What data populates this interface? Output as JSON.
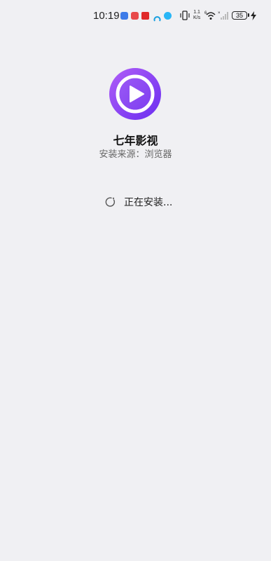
{
  "status_bar": {
    "time": "10:19",
    "net_speed_value": "1.1",
    "net_speed_unit": "K/s",
    "battery_level": "35",
    "notification_icons": [
      "app-notification-blue",
      "app-notification-red",
      "app-notification-red-tv",
      "app-notification-arc",
      "app-notification-globe"
    ]
  },
  "app": {
    "name": "七年影视",
    "source": "安装来源：浏览器",
    "accent_color": "#7b3cf0"
  },
  "install": {
    "status": "正在安装..."
  }
}
